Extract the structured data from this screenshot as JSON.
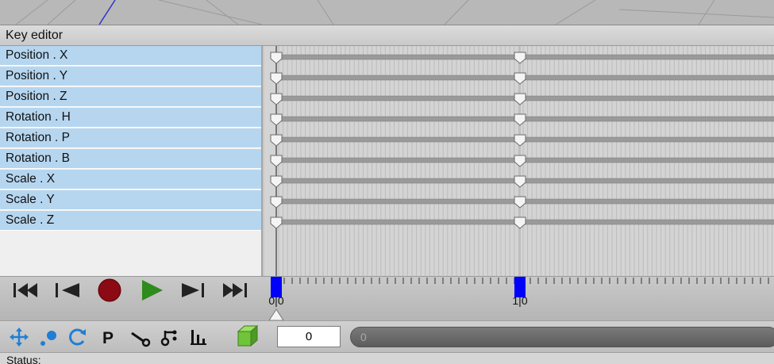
{
  "key_editor": {
    "title": "Key editor",
    "channels": [
      {
        "label": "Position . X"
      },
      {
        "label": "Position . Y"
      },
      {
        "label": "Position . Z"
      },
      {
        "label": "Rotation . H"
      },
      {
        "label": "Rotation . P"
      },
      {
        "label": "Rotation . B"
      },
      {
        "label": "Scale . X"
      },
      {
        "label": "Scale . Y"
      },
      {
        "label": "Scale . Z"
      }
    ],
    "key_frames": [
      0,
      10
    ]
  },
  "timeline": {
    "ruler_labels": [
      "0|0",
      "1|0"
    ],
    "current_frame": 0
  },
  "transport": {
    "buttons": [
      "go-to-start",
      "previous-frame",
      "record",
      "play",
      "next-frame",
      "go-to-end"
    ]
  },
  "toolbar": {
    "tools": [
      "move-icon",
      "scale-point-icon",
      "rotate-icon",
      "parameter-icon",
      "bone-icon",
      "hierarchy-icon",
      "bars-icon",
      "object-cube-icon"
    ],
    "frame_value": "0",
    "slider_value": "0"
  },
  "status": {
    "label": "Status:"
  },
  "colors": {
    "channel_bg": "#b6d6f0",
    "key_marker": "#0000ff",
    "record": "#8b0a14",
    "play": "#2e8b1e",
    "cube": "#6fc43a"
  }
}
